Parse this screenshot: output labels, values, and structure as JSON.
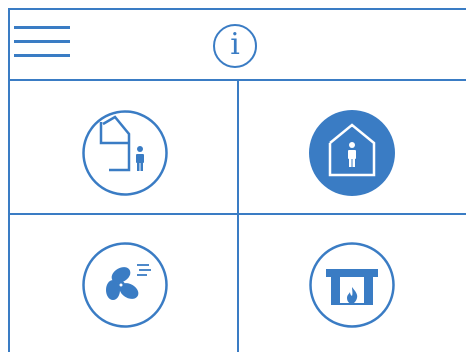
{
  "theme": {
    "accent": "#3a7cc4",
    "background": "#ffffff"
  },
  "header": {
    "menu_icon": "hamburger-menu-icon",
    "info_icon": "info-icon",
    "info_glyph": "i"
  },
  "tiles": [
    {
      "id": "away",
      "icon": "person-leaving-house-icon",
      "selected": false
    },
    {
      "id": "home",
      "icon": "person-in-house-icon",
      "selected": true
    },
    {
      "id": "ventilation",
      "icon": "fan-icon",
      "selected": false
    },
    {
      "id": "fireplace",
      "icon": "fireplace-icon",
      "selected": false
    }
  ]
}
